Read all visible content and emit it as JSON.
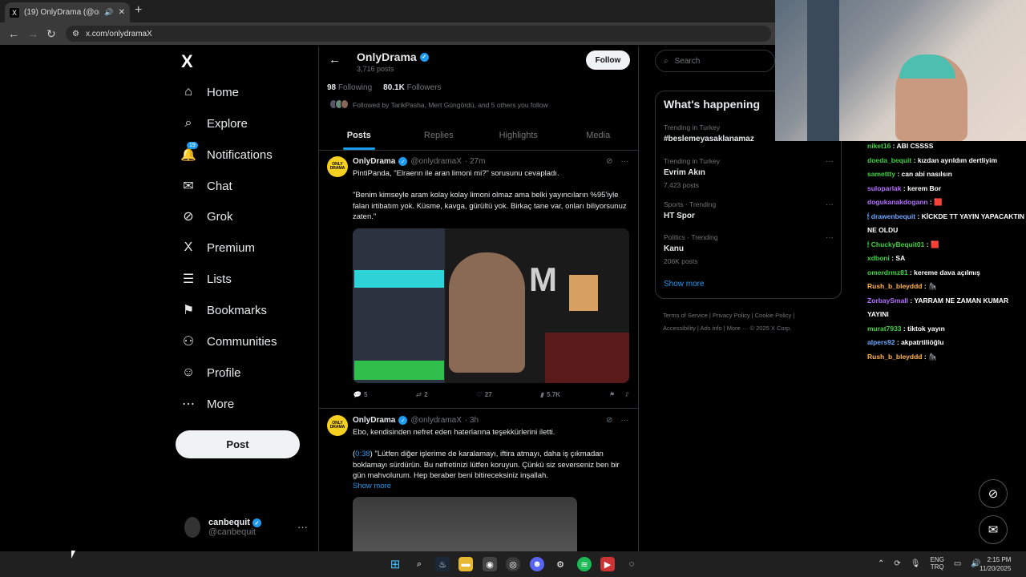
{
  "browser": {
    "tab_title": "(19) OnlyDrama (@onlydrama",
    "tab_favicon": "X",
    "new_tab": "+",
    "url": "x.com/onlydramaX"
  },
  "sidebar": {
    "logo": "X",
    "items": [
      {
        "label": "Home",
        "icon": "home-icon",
        "glyph": "⌂"
      },
      {
        "label": "Explore",
        "icon": "search-icon",
        "glyph": "⌕"
      },
      {
        "label": "Notifications",
        "icon": "bell-icon",
        "glyph": "🔔",
        "badge": "19"
      },
      {
        "label": "Chat",
        "icon": "mail-icon",
        "glyph": "✉"
      },
      {
        "label": "Grok",
        "icon": "grok-icon",
        "glyph": "⊘"
      },
      {
        "label": "Premium",
        "icon": "x-icon",
        "glyph": "X"
      },
      {
        "label": "Lists",
        "icon": "list-icon",
        "glyph": "☰"
      },
      {
        "label": "Bookmarks",
        "icon": "bookmark-icon",
        "glyph": "⚑"
      },
      {
        "label": "Communities",
        "icon": "communities-icon",
        "glyph": "⚇"
      },
      {
        "label": "Profile",
        "icon": "person-icon",
        "glyph": "☺"
      },
      {
        "label": "More",
        "icon": "more-circle-icon",
        "glyph": "⋯"
      }
    ],
    "post_button": "Post",
    "account": {
      "name": "canbequit",
      "handle": "@canbequit",
      "more": "···"
    }
  },
  "profile": {
    "name": "OnlyDrama",
    "posts_count": "3,716 posts",
    "follow_label": "Follow",
    "following_count": "98",
    "following_label": "Following",
    "followers_count": "80.1K",
    "followers_label": "Followers",
    "followed_by": "Followed by TarikPasha, Mert Güngördü, and 5 others you follow",
    "tabs": [
      "Posts",
      "Replies",
      "Highlights",
      "Media"
    ]
  },
  "tweets": [
    {
      "name": "OnlyDrama",
      "handle": "@onlydramaX",
      "time": "· 27m",
      "avatar_text": "ONLY DRAMA",
      "text_1": "PintiPanda, \"Elraenn ile aran limoni mi?\" sorusunu cevapladı.",
      "text_2": "\"Benim kimseyle aram kolay kolay limoni olmaz ama belki yayıncıların %95'iyle falan irtibatım yok. Küsme, kavga, gürültü yok. Birkaç tane var, onları biliyorsunuz zaten.\"",
      "replies": "5",
      "reposts": "2",
      "likes": "27",
      "views": "5.7K"
    },
    {
      "name": "OnlyDrama",
      "handle": "@onlydramaX",
      "time": "· 3h",
      "avatar_text": "ONLY DRAMA",
      "text_1": "Ebo, kendisinden nefret eden haterlarına teşekkürlerini iletti.",
      "timestamp_link": "0:38",
      "text_2": "\"Lütfen diğer işlerime de karalamayı, iftira atmayı, daha iş çıkmadan boklamayı sürdürün. Bu nefretinizi lütfen koruyun. Çünkü siz severseniz ben bir gün mahvolurum. Hep beraber beni bitireceksiniz inşallah.",
      "show_more": "Show more"
    }
  ],
  "right": {
    "search_placeholder": "Search",
    "happening_title": "What's happening",
    "trends": [
      {
        "context": "Trending in Turkey",
        "title": "#besleme­yasaklanamaz",
        "posts": ""
      },
      {
        "context": "Trending in Turkey",
        "title": "Evrim Akın",
        "posts": "7,423 posts"
      },
      {
        "context": "Sports · Trending",
        "title": "HT Spor",
        "posts": ""
      },
      {
        "context": "Politics · Trending",
        "title": "Kanu",
        "posts": "206K posts"
      }
    ],
    "show_more": "Show more",
    "footer_line1": "Terms of Service  |  Privacy Policy  |  Cookie Policy  |",
    "footer_line2": "Accessibility  |  Ads info  |  More ···  © 2025 X Corp."
  },
  "stream_chat": [
    {
      "user": "niket16",
      "color": "#3fd13f",
      "msg": "ABI CSSSS"
    },
    {
      "user": "doeda_bequit",
      "color": "#3fd13f",
      "msg": "kızdan ayrıldım dertliyim"
    },
    {
      "user": "samettty",
      "color": "#3fd13f",
      "msg": "can abi nasılsın"
    },
    {
      "user": "suloparlak",
      "color": "#b46fff",
      "msg": "kerem Bor"
    },
    {
      "user": "dogukanakdogann",
      "color": "#b46fff",
      "msg": "🟥"
    },
    {
      "user": "🕯 drawenbequit",
      "color": "#6fa8ff",
      "msg": "KİCKDE TT YAYIN YAPACAKTIN NE OLDU"
    },
    {
      "user": "🕯 ChuckyBequit01",
      "color": "#3fd13f",
      "msg": "🟥"
    },
    {
      "user": "xdboni",
      "color": "#3fd13f",
      "msg": "SA"
    },
    {
      "user": "omerdrmz81",
      "color": "#3fd13f",
      "msg": "kereme dava açılmış"
    },
    {
      "user": "Rush_b_bleyddd",
      "color": "#ffb347",
      "msg": "🦍"
    },
    {
      "user": "ZorbaySmall",
      "color": "#b46fff",
      "msg": "YARRAM NE ZAMAN KUMAR YAYINI"
    },
    {
      "user": "murat7933",
      "color": "#3fd13f",
      "msg": "tiktok yayın"
    },
    {
      "user": "alpers92",
      "color": "#6fa8ff",
      "msg": "akpatrtiliöğlu"
    },
    {
      "user": "Rush_b_bleyddd",
      "color": "#ffb347",
      "msg": "🦍"
    }
  ],
  "taskbar": {
    "lang_top": "ENG",
    "lang_bottom": "TRQ",
    "time": "2:15 PM",
    "date": "11/20/2025"
  },
  "colors": {
    "accent": "#1d9bf0",
    "background": "#000000",
    "border": "#2f3336",
    "muted": "#71767b"
  }
}
